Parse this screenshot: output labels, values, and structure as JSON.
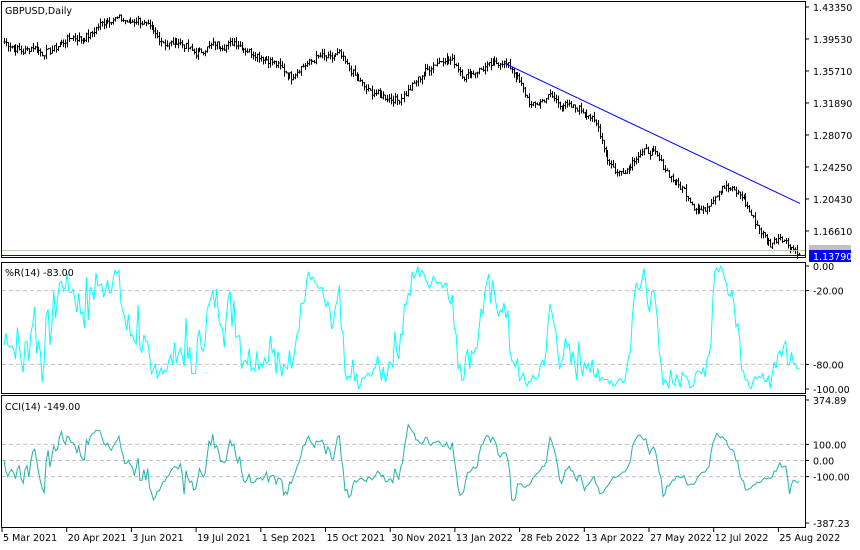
{
  "chart_data": [
    {
      "type": "ohlc",
      "title": "GBPUSD,Daily",
      "symbol": "GBPUSD",
      "timeframe": "Daily",
      "y_ticks": [
        "1.43350",
        "1.39530",
        "1.35710",
        "1.31890",
        "1.28070",
        "1.24250",
        "1.20430",
        "1.16610"
      ],
      "ylim": [
        1.13,
        1.4395
      ],
      "current_price": "1.13790",
      "x_ticks": [
        "5 Mar 2021",
        "20 Apr 2021",
        "3 Jun 2021",
        "19 Jul 2021",
        "1 Sep 2021",
        "15 Oct 2021",
        "30 Nov 2021",
        "13 Jan 2022",
        "28 Feb 2022",
        "13 Apr 2022",
        "27 May 2022",
        "12 Jul 2022",
        "25 Aug 2022"
      ],
      "weekly_closes": [
        1.392,
        1.385,
        1.38,
        1.386,
        1.378,
        1.382,
        1.39,
        1.398,
        1.395,
        1.4,
        1.413,
        1.418,
        1.42,
        1.415,
        1.418,
        1.41,
        1.398,
        1.388,
        1.393,
        1.386,
        1.378,
        1.383,
        1.39,
        1.386,
        1.392,
        1.384,
        1.378,
        1.373,
        1.368,
        1.36,
        1.35,
        1.362,
        1.368,
        1.375,
        1.372,
        1.378,
        1.36,
        1.346,
        1.333,
        1.33,
        1.325,
        1.322,
        1.33,
        1.345,
        1.357,
        1.366,
        1.372,
        1.368,
        1.35,
        1.355,
        1.36,
        1.366,
        1.368,
        1.36,
        1.34,
        1.315,
        1.32,
        1.328,
        1.318,
        1.315,
        1.312,
        1.305,
        1.29,
        1.252,
        1.235,
        1.24,
        1.255,
        1.262,
        1.258,
        1.24,
        1.224,
        1.215,
        1.195,
        1.19,
        1.205,
        1.22,
        1.215,
        1.208,
        1.185,
        1.165,
        1.15,
        1.16,
        1.148,
        1.14
      ],
      "trendline": {
        "start_price": 1.366,
        "end_price": 1.199,
        "color": "#0000ff"
      }
    },
    {
      "type": "line",
      "title": "%R(14) -83.00",
      "name": "%R(14)",
      "last": "-83.00",
      "color": "#00ffff",
      "ylim": [
        -100,
        0
      ],
      "y_ticks": [
        "0.00",
        "-20.00",
        "-80.00",
        "-100.00"
      ],
      "levels": [
        -20,
        -80
      ]
    },
    {
      "type": "line",
      "title": "CCI(14) -149.00",
      "name": "CCI(14)",
      "last": "-149.00",
      "color": "#20b2aa",
      "ylim": [
        -387.23,
        374.89
      ],
      "y_ticks": [
        "374.89",
        "100.00",
        "0.00",
        "-100.00",
        "-387.23"
      ],
      "levels": [
        100,
        0,
        -100
      ]
    }
  ]
}
